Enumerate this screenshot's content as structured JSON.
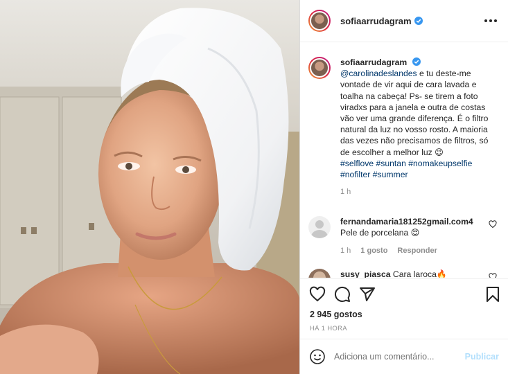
{
  "header": {
    "username": "sofiaarrudagram"
  },
  "caption": {
    "username": "sofiaarrudagram",
    "mention": "@carolinadeslandes",
    "text": " e tu deste-me vontade de vir aqui de cara lavada e toalha na cabeça! Ps- se tirem a foto viradxs para a janela e outra de costas vão ver uma grande diferença. É o filtro natural da luz no vosso rosto. A maioria das vezes não precisamos de filtros, só de escolher a melhor luz 😉",
    "hashtags": "#selflove #suntan #nomakeupselfie #nofilter #summer",
    "time": "1 h"
  },
  "comments": [
    {
      "username": "fernandamaria181252gmail.com4",
      "text": "Pele de porcelana 😍",
      "time": "1 h",
      "likes": "1 gosto",
      "reply": "Responder"
    },
    {
      "username": "susy_piasca",
      "text": "Cara laroca🔥"
    }
  ],
  "likes_count": "2 945 gostos",
  "posted_ago": "HÁ 1 HORA",
  "comment_input": {
    "placeholder": "Adiciona um comentário...",
    "publish": "Publicar"
  },
  "colors": {
    "verified_badge": "#3897f0",
    "link": "#00376b",
    "muted": "#8e8e8e",
    "publish_disabled": "#b2dffc"
  },
  "icons": [
    "more-options-icon",
    "verified-badge-icon",
    "heart-icon",
    "comment-icon",
    "share-icon",
    "bookmark-icon",
    "emoji-icon"
  ]
}
